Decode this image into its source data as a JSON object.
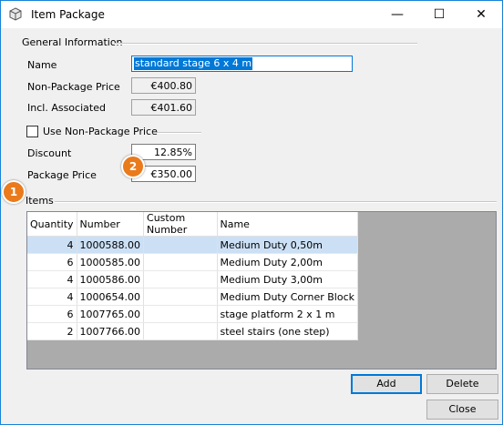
{
  "window": {
    "title": "Item Package",
    "minimize_glyph": "—",
    "maximize_glyph": "☐",
    "close_glyph": "✕"
  },
  "general": {
    "group_label": "General Information",
    "name_label": "Name",
    "name_value": "standard stage 6 x 4 m",
    "non_package_price_label": "Non-Package Price",
    "non_package_price_value": "€400.80",
    "incl_associated_label": "Incl. Associated",
    "incl_associated_value": "€401.60"
  },
  "use_non_package": {
    "label": "Use Non-Package Price",
    "checked": false
  },
  "discount": {
    "label": "Discount",
    "value": "12.85%"
  },
  "package_price": {
    "label": "Package Price",
    "value": "€350.00"
  },
  "badges": {
    "one": "1",
    "two": "2"
  },
  "items": {
    "group_label": "Items",
    "columns": [
      "Quantity",
      "Number",
      "Custom Number",
      "Name"
    ],
    "rows": [
      {
        "quantity": "4",
        "number": "1000588.00",
        "custom": "",
        "name": "Medium Duty 0,50m",
        "selected": true
      },
      {
        "quantity": "6",
        "number": "1000585.00",
        "custom": "",
        "name": "Medium Duty 2,00m"
      },
      {
        "quantity": "4",
        "number": "1000586.00",
        "custom": "",
        "name": "Medium Duty 3,00m"
      },
      {
        "quantity": "4",
        "number": "1000654.00",
        "custom": "",
        "name": "Medium Duty Corner Block"
      },
      {
        "quantity": "6",
        "number": "1007765.00",
        "custom": "",
        "name": "stage platform 2 x 1 m"
      },
      {
        "quantity": "2",
        "number": "1007766.00",
        "custom": "",
        "name": "steel stairs (one step)"
      }
    ]
  },
  "buttons": {
    "add": "Add",
    "delete": "Delete",
    "close": "Close"
  },
  "colors": {
    "accent": "#0078d7",
    "badge": "#ea7a1b",
    "selected_row": "#cce0f5"
  }
}
